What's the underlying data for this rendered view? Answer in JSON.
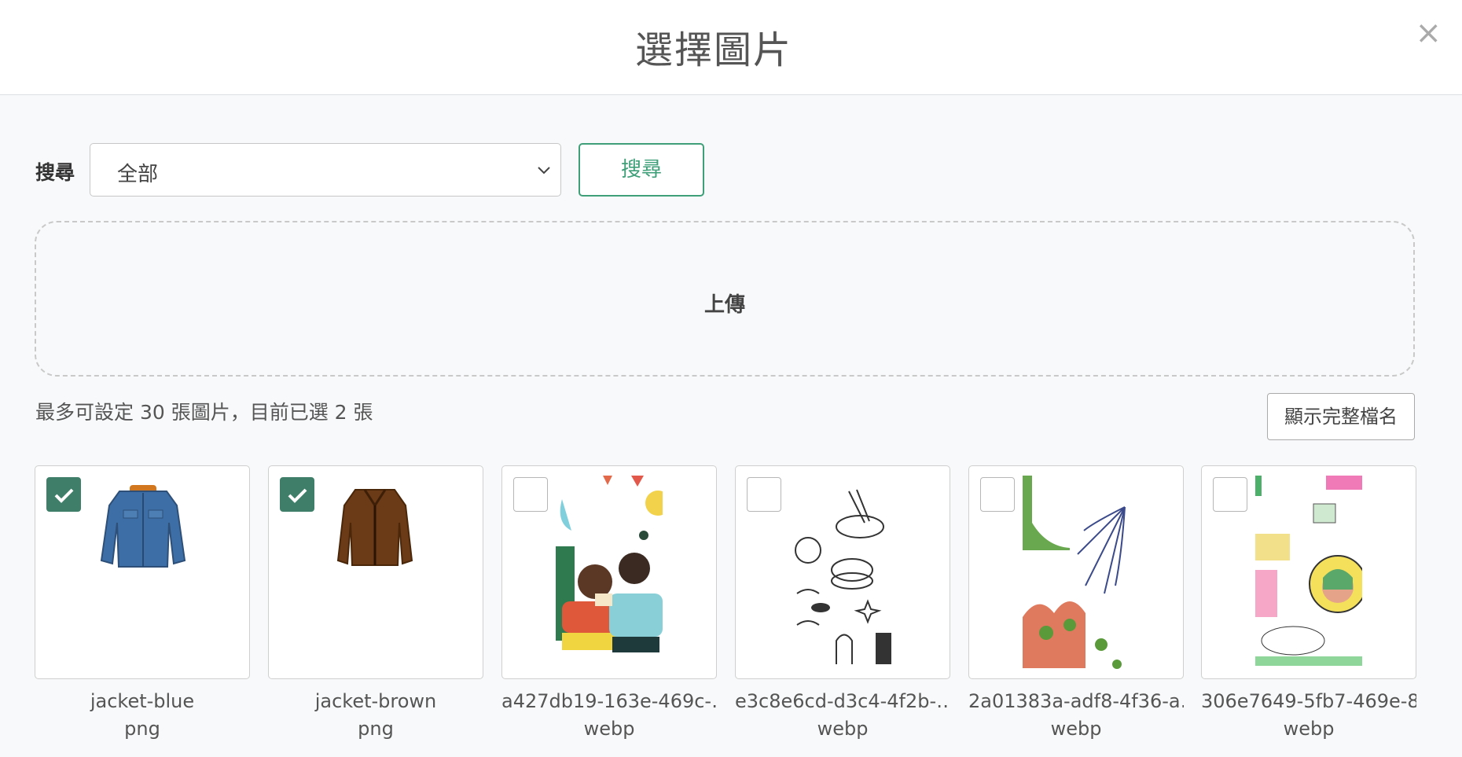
{
  "header": {
    "title": "選擇圖片",
    "close_symbol": "×"
  },
  "search": {
    "label": "搜尋",
    "selected": "全部",
    "button": "搜尋"
  },
  "upload": {
    "label": "上傳"
  },
  "status": {
    "limit_text": "最多可設定 30 張圖片，目前已選 2 張",
    "max": 30,
    "selected_count": 2
  },
  "toggle_fullname": {
    "label": "顯示完整檔名"
  },
  "colors": {
    "accent": "#3e9f78",
    "checked": "#3f7f6a"
  },
  "images": [
    {
      "name": "jacket-blue",
      "ext": "png",
      "checked": true,
      "thumb": "blue-jacket"
    },
    {
      "name": "jacket-brown",
      "ext": "png",
      "checked": true,
      "thumb": "brown-jacket"
    },
    {
      "name": "a427db19-163e-469c-…",
      "ext": "webp",
      "checked": false,
      "thumb": "birthday-illustration"
    },
    {
      "name": "e3c8e6cd-d3c4-4f2b-…",
      "ext": "webp",
      "checked": false,
      "thumb": "doodle-pattern"
    },
    {
      "name": "2a01383a-adf8-4f36-a…",
      "ext": "webp",
      "checked": false,
      "thumb": "abstract-leaves"
    },
    {
      "name": "306e7649-5fb7-469e-8…",
      "ext": "webp",
      "checked": false,
      "thumb": "sticker-collage"
    }
  ]
}
